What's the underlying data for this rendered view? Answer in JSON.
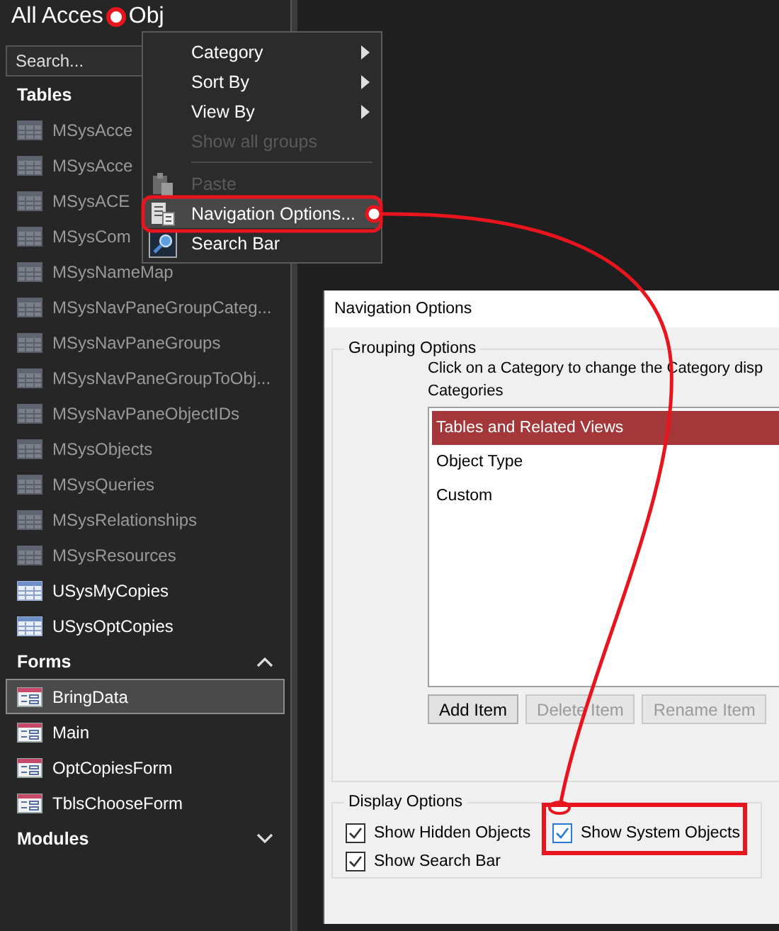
{
  "nav_pane": {
    "title_parts": [
      "All Acces",
      "Obj"
    ],
    "search": {
      "placeholder": "Search..."
    },
    "groups": [
      {
        "label": "Tables",
        "items": [
          {
            "label": "MSysAcce",
            "kind": "table",
            "system": true,
            "selected": false
          },
          {
            "label": "MSysAcce",
            "kind": "table",
            "system": true,
            "selected": false
          },
          {
            "label": "MSysACE",
            "kind": "table",
            "system": true,
            "selected": false
          },
          {
            "label": "MSysCom",
            "kind": "table",
            "system": true,
            "selected": false
          },
          {
            "label": "MSysNameMap",
            "kind": "table",
            "system": true,
            "selected": false
          },
          {
            "label": "MSysNavPaneGroupCateg...",
            "kind": "table",
            "system": true,
            "selected": false
          },
          {
            "label": "MSysNavPaneGroups",
            "kind": "table",
            "system": true,
            "selected": false
          },
          {
            "label": "MSysNavPaneGroupToObj...",
            "kind": "table",
            "system": true,
            "selected": false
          },
          {
            "label": "MSysNavPaneObjectIDs",
            "kind": "table",
            "system": true,
            "selected": false
          },
          {
            "label": "MSysObjects",
            "kind": "table",
            "system": true,
            "selected": false
          },
          {
            "label": "MSysQueries",
            "kind": "table",
            "system": true,
            "selected": false
          },
          {
            "label": "MSysRelationships",
            "kind": "table",
            "system": true,
            "selected": false
          },
          {
            "label": "MSysResources",
            "kind": "table",
            "system": true,
            "selected": false
          },
          {
            "label": "USysMyCopies",
            "kind": "table",
            "system": false,
            "selected": false
          },
          {
            "label": "USysOptCopies",
            "kind": "table",
            "system": false,
            "selected": false
          }
        ]
      },
      {
        "label": "Forms",
        "expanded": true,
        "items": [
          {
            "label": "BringData",
            "kind": "form",
            "system": false,
            "selected": true
          },
          {
            "label": "Main",
            "kind": "form",
            "system": false,
            "selected": false
          },
          {
            "label": "OptCopiesForm",
            "kind": "form",
            "system": false,
            "selected": false
          },
          {
            "label": "TblsChooseForm",
            "kind": "form",
            "system": false,
            "selected": false
          }
        ]
      },
      {
        "label": "Modules",
        "expanded": false
      }
    ]
  },
  "context_menu": {
    "items": [
      {
        "kind": "submenu",
        "label": "Category",
        "disabled": false,
        "selected": false
      },
      {
        "kind": "submenu",
        "label": "Sort By",
        "disabled": false,
        "selected": false
      },
      {
        "kind": "submenu",
        "label": "View By",
        "disabled": false,
        "selected": false
      },
      {
        "kind": "command",
        "label": "Show all groups",
        "disabled": true,
        "selected": false
      },
      {
        "kind": "separator"
      },
      {
        "kind": "paste",
        "label": "Paste",
        "disabled": true,
        "selected": false
      },
      {
        "kind": "options",
        "label": "Navigation Options...",
        "disabled": false,
        "selected": true
      },
      {
        "kind": "searchbar",
        "label": "Search Bar",
        "disabled": false,
        "selected": false
      }
    ]
  },
  "dialog": {
    "title": "Navigation Options",
    "grouping": {
      "legend": "Grouping Options",
      "instruction": "Click on a Category to change the Category disp",
      "categories_label": "Categories",
      "categories": [
        {
          "label": "Tables and Related Views",
          "selected": true
        },
        {
          "label": "Object Type",
          "selected": false
        },
        {
          "label": "Custom",
          "selected": false
        }
      ],
      "buttons": [
        {
          "label": "Add Item",
          "disabled": false
        },
        {
          "label": "Delete Item",
          "disabled": true
        },
        {
          "label": "Rename Item",
          "disabled": true
        }
      ]
    },
    "display": {
      "legend": "Display Options",
      "checkboxes": [
        {
          "label": "Show Hidden Objects",
          "checked": true
        },
        {
          "label": "Show System Objects",
          "checked": true
        },
        {
          "label": "Show Search Bar",
          "checked": true
        }
      ]
    }
  }
}
